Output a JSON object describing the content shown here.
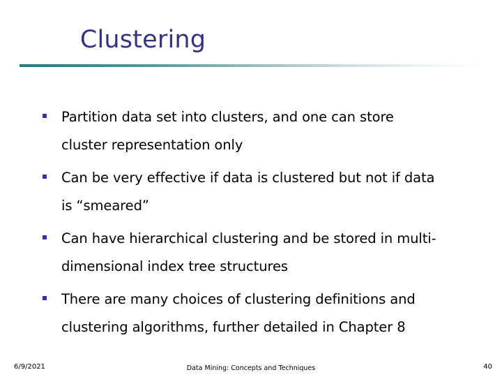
{
  "slide": {
    "title": "Clustering",
    "title_color": "#333380",
    "background_color": "#ffffff",
    "rule": {
      "start_color": "#1f7d80",
      "end_color": "#ffffff"
    },
    "bullet_marker_color": "#3333a8",
    "bullets": [
      {
        "marker": "square-bullet",
        "text": "Partition data set into clusters, and one can store\ncluster representation only"
      },
      {
        "marker": "square-bullet",
        "text": "Can be very effective if data is clustered but not if data\nis “smeared”"
      },
      {
        "marker": "square-bullet",
        "text": "Can have hierarchical clustering and be stored in multi-\ndimensional index tree structures"
      },
      {
        "marker": "square-bullet",
        "text": "There are many choices of clustering definitions and\nclustering algorithms, further detailed in Chapter 8"
      }
    ],
    "footer": {
      "date": "6/9/2021",
      "center": "Data Mining: Concepts and Techniques",
      "page_number": "40"
    }
  }
}
